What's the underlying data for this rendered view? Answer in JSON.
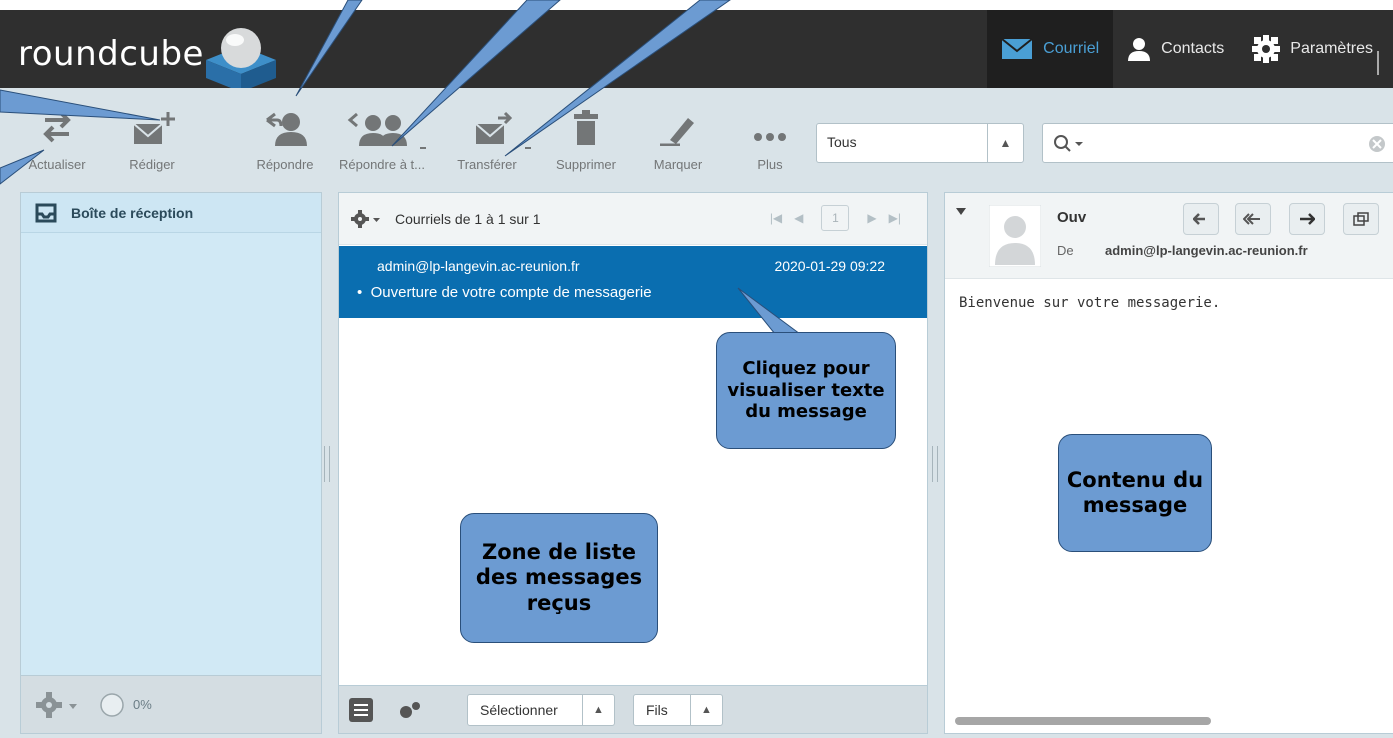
{
  "header": {
    "logo_text": "roundcube",
    "nav": [
      {
        "label": "Courriel",
        "icon": "mail-icon",
        "active": true
      },
      {
        "label": "Contacts",
        "icon": "person-icon",
        "active": false
      },
      {
        "label": "Paramètres",
        "icon": "gear-icon",
        "active": false
      }
    ]
  },
  "toolbar": {
    "buttons": [
      {
        "label": "Actualiser",
        "icon": "refresh-icon"
      },
      {
        "label": "Rédiger",
        "icon": "compose-icon"
      },
      {
        "label": "Répondre",
        "icon": "reply-icon"
      },
      {
        "label": "Répondre à t...",
        "icon": "reply-all-icon"
      },
      {
        "label": "Transférer",
        "icon": "forward-icon"
      },
      {
        "label": "Supprimer",
        "icon": "trash-icon"
      },
      {
        "label": "Marquer",
        "icon": "mark-pen-icon"
      },
      {
        "label": "Plus",
        "icon": "more-icon"
      }
    ],
    "filter_value": "Tous",
    "search_placeholder": ""
  },
  "folders": {
    "items": [
      {
        "label": "Boîte de réception",
        "icon": "inbox-icon",
        "selected": true
      }
    ],
    "quota": "0%"
  },
  "message_list": {
    "count_text": "Courriels de 1 à 1 sur 1",
    "page": "1",
    "messages": [
      {
        "from": "admin@lp-langevin.ac-reunion.fr",
        "date": "2020-01-29 09:22",
        "subject": "Ouverture de votre compte de messagerie",
        "selected": true
      }
    ],
    "footer": {
      "select_label": "Sélectionner",
      "threads_label": "Fils"
    }
  },
  "preview": {
    "subject": "Ouv",
    "from_label": "De",
    "from": "admin@lp-langevin.ac-reunion.fr",
    "body": "Bienvenue sur votre messagerie."
  },
  "annotations": {
    "click_hint": "Cliquez pour visualiser texte du message",
    "list_zone": "Zone de liste des messages reçus",
    "content_zone": "Contenu du message"
  },
  "colors": {
    "header_bg": "#2f2f2f",
    "toolbar_bg": "#d9e3e8",
    "selected_row": "#0a6eb0",
    "accent": "#4a9fd5",
    "callout_fill": "#6c9bd2"
  }
}
